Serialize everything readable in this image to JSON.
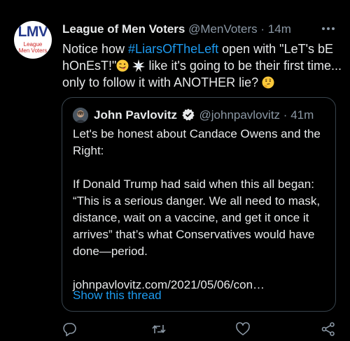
{
  "avatar": {
    "logo_text": "LMV",
    "logo_sub_line1": "League",
    "logo_sub_line2": "Men Voters"
  },
  "author": {
    "name": "League of Men Voters",
    "handle": "@MenVoters",
    "separator": "·",
    "time": "14m"
  },
  "tweet": {
    "text_part1": "Notice how ",
    "hashtag": "#LiarsOfTheLeft",
    "text_part2": " open with \"LeT's bE hOnEsT!\"",
    "text_part3": " like it's going to be their first time... only to follow it with ANOTHER lie? ",
    "emoji_1": "winking-face-tongue",
    "emoji_2": "collision",
    "emoji_3": "thinking-face"
  },
  "quoted": {
    "name": "John Pavlovitz",
    "handle": "@johnpavlovitz",
    "separator": "·",
    "time": "41m",
    "paragraph1": "Let's be honest about Candace Owens and the Right:",
    "paragraph2": "If Donald Trump had said when this all began: “This is a serious danger. We all need to mask, distance, wait on a vaccine, and get it once it arrives” that’s what Conservatives would have done—period.",
    "link": "johnpavlovitz.com/2021/05/06/con…",
    "show_thread": "Show this thread"
  },
  "actions": {
    "reply_icon": "reply-icon",
    "retweet_icon": "retweet-icon",
    "like_icon": "like-icon",
    "share_icon": "share-icon"
  },
  "colors": {
    "background": "#000000",
    "text": "#e7e9ea",
    "secondary": "#8b98a5",
    "accent": "#1d9bf0",
    "border": "#38444d"
  }
}
